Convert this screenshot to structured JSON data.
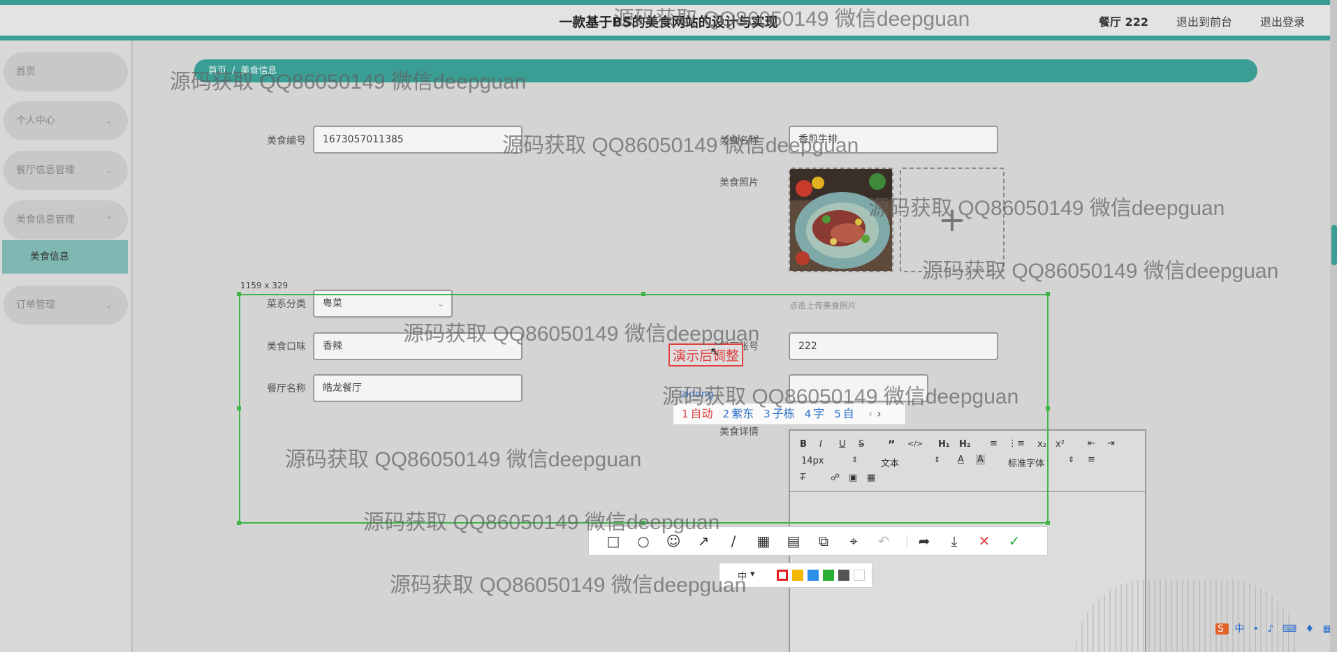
{
  "header": {
    "title": "一款基于BS的美食网站的设计与实现",
    "user": "餐厅 222",
    "front_link": "退出到前台",
    "logout_link": "退出登录"
  },
  "sidebar": {
    "items": [
      {
        "label": "首页"
      },
      {
        "label": "个人中心"
      },
      {
        "label": "餐厅信息管理"
      },
      {
        "label": "美食信息管理"
      },
      {
        "label": "订单管理"
      }
    ],
    "active_sub": "美食信息"
  },
  "breadcrumb": {
    "home": "首页",
    "separator": "/",
    "current": "美食信息"
  },
  "form": {
    "food_id_label": "美食编号",
    "food_id_value": "1673057011385",
    "food_name_label": "美食名称",
    "food_name_value": "香煎牛排",
    "food_photo_label": "美食照片",
    "upload_hint": "点击上传美食照片",
    "cuisine_label": "菜系分类",
    "cuisine_value": "粤菜",
    "taste_label": "美食口味",
    "taste_value": "香辣",
    "restaurant_account_label": "餐厅账号",
    "restaurant_account_value": "222",
    "restaurant_name_label": "餐厅名称",
    "restaurant_name_value": "皓龙餐厅",
    "details_label": "美食详情"
  },
  "editor": {
    "font_size": "14px",
    "paragraph": "文本",
    "font_family": "标准字体"
  },
  "capture": {
    "size_label": "1159 x 329",
    "annotation_text": "演示后调整",
    "ime_input": "zidong",
    "ime_candidates": [
      {
        "num": "1",
        "text": "自动"
      },
      {
        "num": "2",
        "text": "紫东"
      },
      {
        "num": "3",
        "text": "子栋"
      },
      {
        "num": "4",
        "text": "字"
      },
      {
        "num": "5",
        "text": "自"
      }
    ],
    "font_selector": "中"
  },
  "colors": {
    "accent": "#3b9e95",
    "capture_border": "#3db548",
    "swatches": [
      "#e02020",
      "#f5b800",
      "#2e8fe8",
      "#28b034",
      "#555555",
      "#ffffff"
    ]
  },
  "tray": {
    "ime_label": "中"
  },
  "watermark": "源码获取 QQ86050149 微信deepguan"
}
